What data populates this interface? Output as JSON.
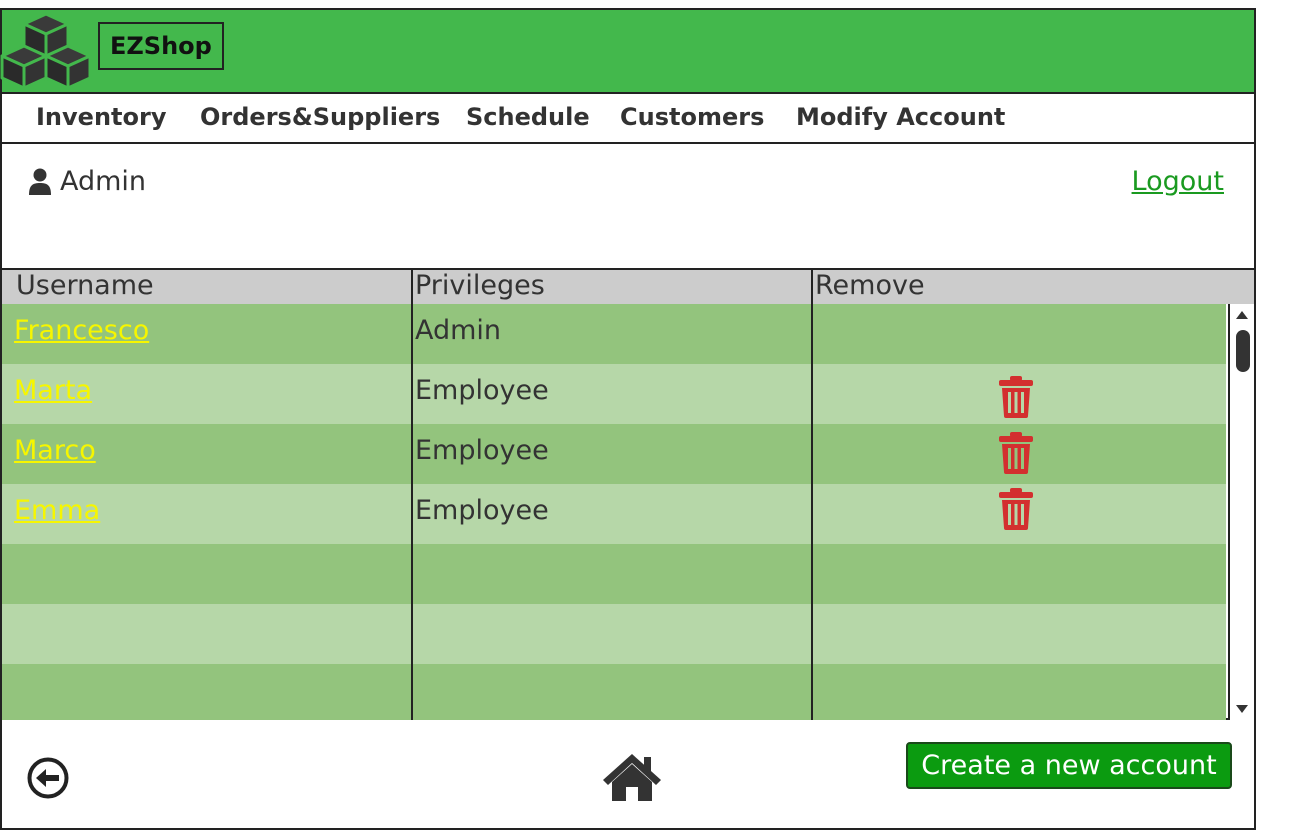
{
  "app": {
    "brand": "EZShop"
  },
  "nav": {
    "items": [
      "Inventory",
      "Orders&Suppliers",
      "Schedule",
      "Customers",
      "Modify Account"
    ]
  },
  "user": {
    "name": "Admin",
    "logout_label": "Logout"
  },
  "table": {
    "headers": [
      "Username",
      "Privileges",
      "Remove"
    ],
    "rows": [
      {
        "username": "Francesco",
        "privileges": "Admin",
        "removable": false
      },
      {
        "username": "Marta",
        "privileges": "Employee",
        "removable": true
      },
      {
        "username": "Marco",
        "privileges": "Employee",
        "removable": true
      },
      {
        "username": "Emma",
        "privileges": "Employee",
        "removable": true
      },
      {
        "username": "",
        "privileges": "",
        "removable": false
      },
      {
        "username": "",
        "privileges": "",
        "removable": false
      },
      {
        "username": "",
        "privileges": "",
        "removable": false
      }
    ]
  },
  "footer": {
    "create_label": "Create a new account"
  },
  "colors": {
    "header_green": "#43b84c",
    "row_dark": "#93c47d",
    "row_light": "#b6d7a8",
    "username_link": "#f6f600",
    "trash_red": "#d32f2f",
    "create_button": "#0b9b10",
    "logout_link": "#1a9a20"
  },
  "icons": [
    "cubes-logo-icon",
    "user-icon",
    "trash-icon",
    "back-arrow-icon",
    "home-icon",
    "scroll-up-icon",
    "scroll-down-icon"
  ]
}
